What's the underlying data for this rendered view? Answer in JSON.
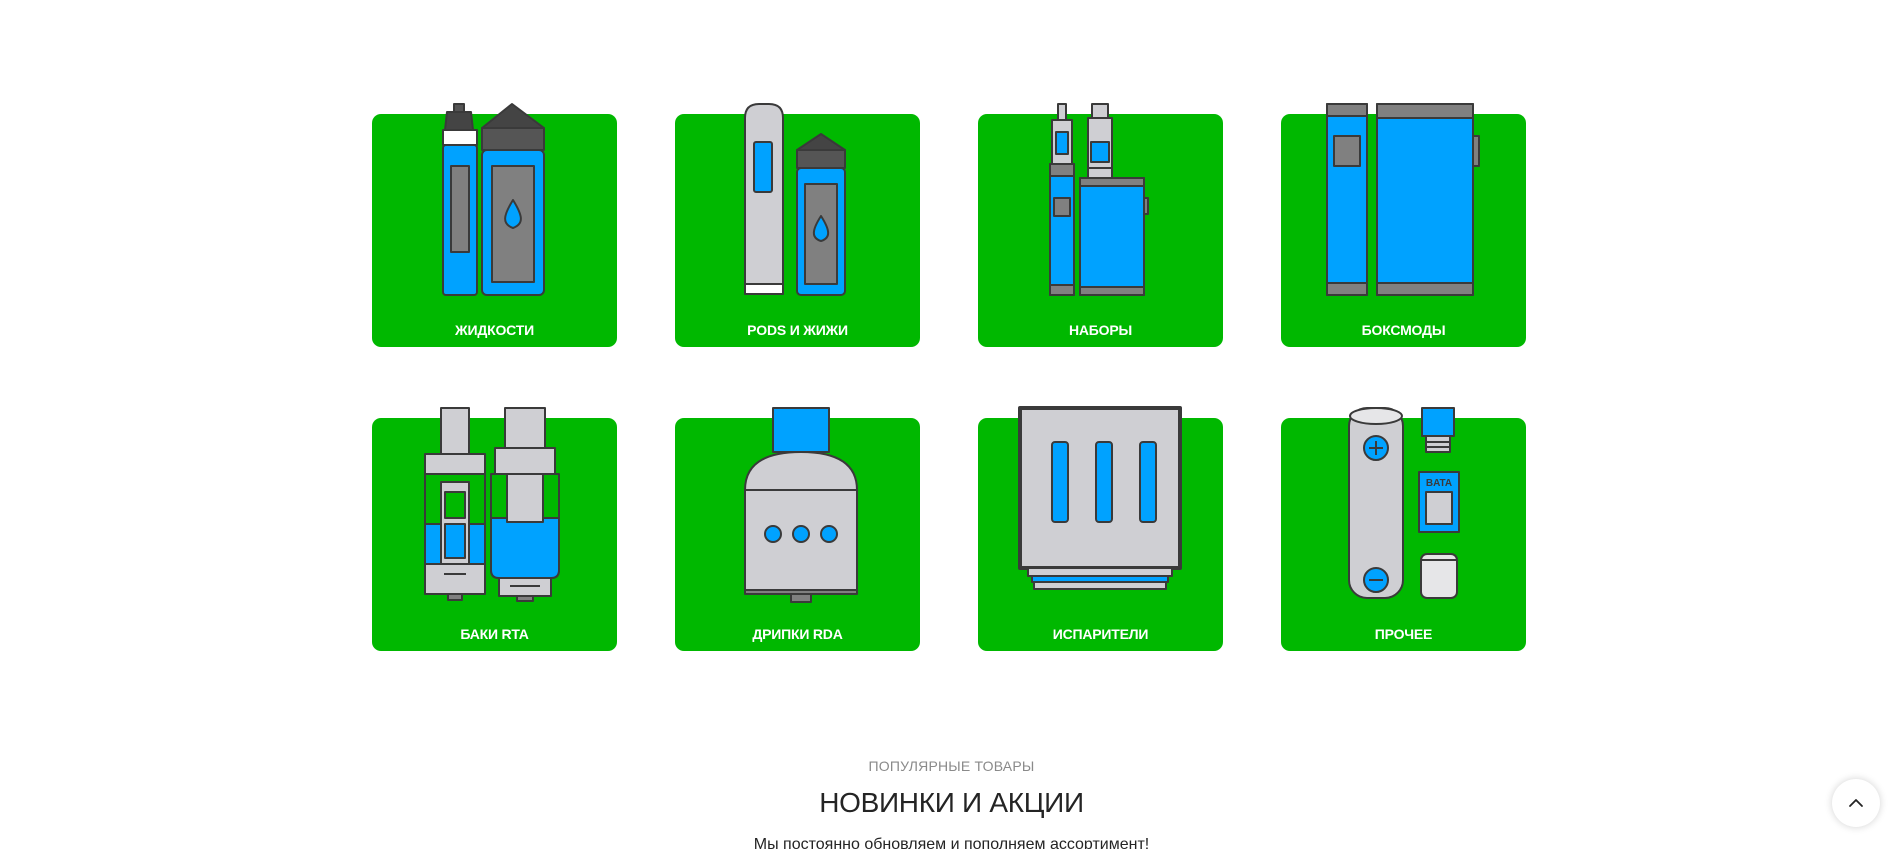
{
  "categories": [
    {
      "label": "ЖИДКОСТИ",
      "icon": "e-liquid-bottles-icon"
    },
    {
      "label": "PODS И ЖИЖИ",
      "icon": "pod-and-liquid-icon"
    },
    {
      "label": "НАБОРЫ",
      "icon": "vape-kit-icon"
    },
    {
      "label": "БОКСМОДЫ",
      "icon": "box-mod-icon"
    },
    {
      "label": "БАКИ RTA",
      "icon": "rta-tank-icon"
    },
    {
      "label": "ДРИПКИ RDA",
      "icon": "rda-dripper-icon"
    },
    {
      "label": "ИСПАРИТЕЛИ",
      "icon": "coil-icon"
    },
    {
      "label": "ПРОЧЕЕ",
      "icon": "accessories-icon"
    }
  ],
  "popular": {
    "eyebrow": "ПОПУЛЯРНЫЕ ТОВАРЫ",
    "title": "НОВИНКИ И АКЦИИ",
    "subtitle": "Мы постоянно обновляем и пополняем ассортимент!"
  },
  "scroll_top": {
    "icon": "chevron-up-icon"
  },
  "colors": {
    "card_green": "#00b800",
    "accent_blue": "#00a2ff",
    "outline_dark": "#3a3a3a",
    "metal_grey": "#c8c8cc"
  }
}
